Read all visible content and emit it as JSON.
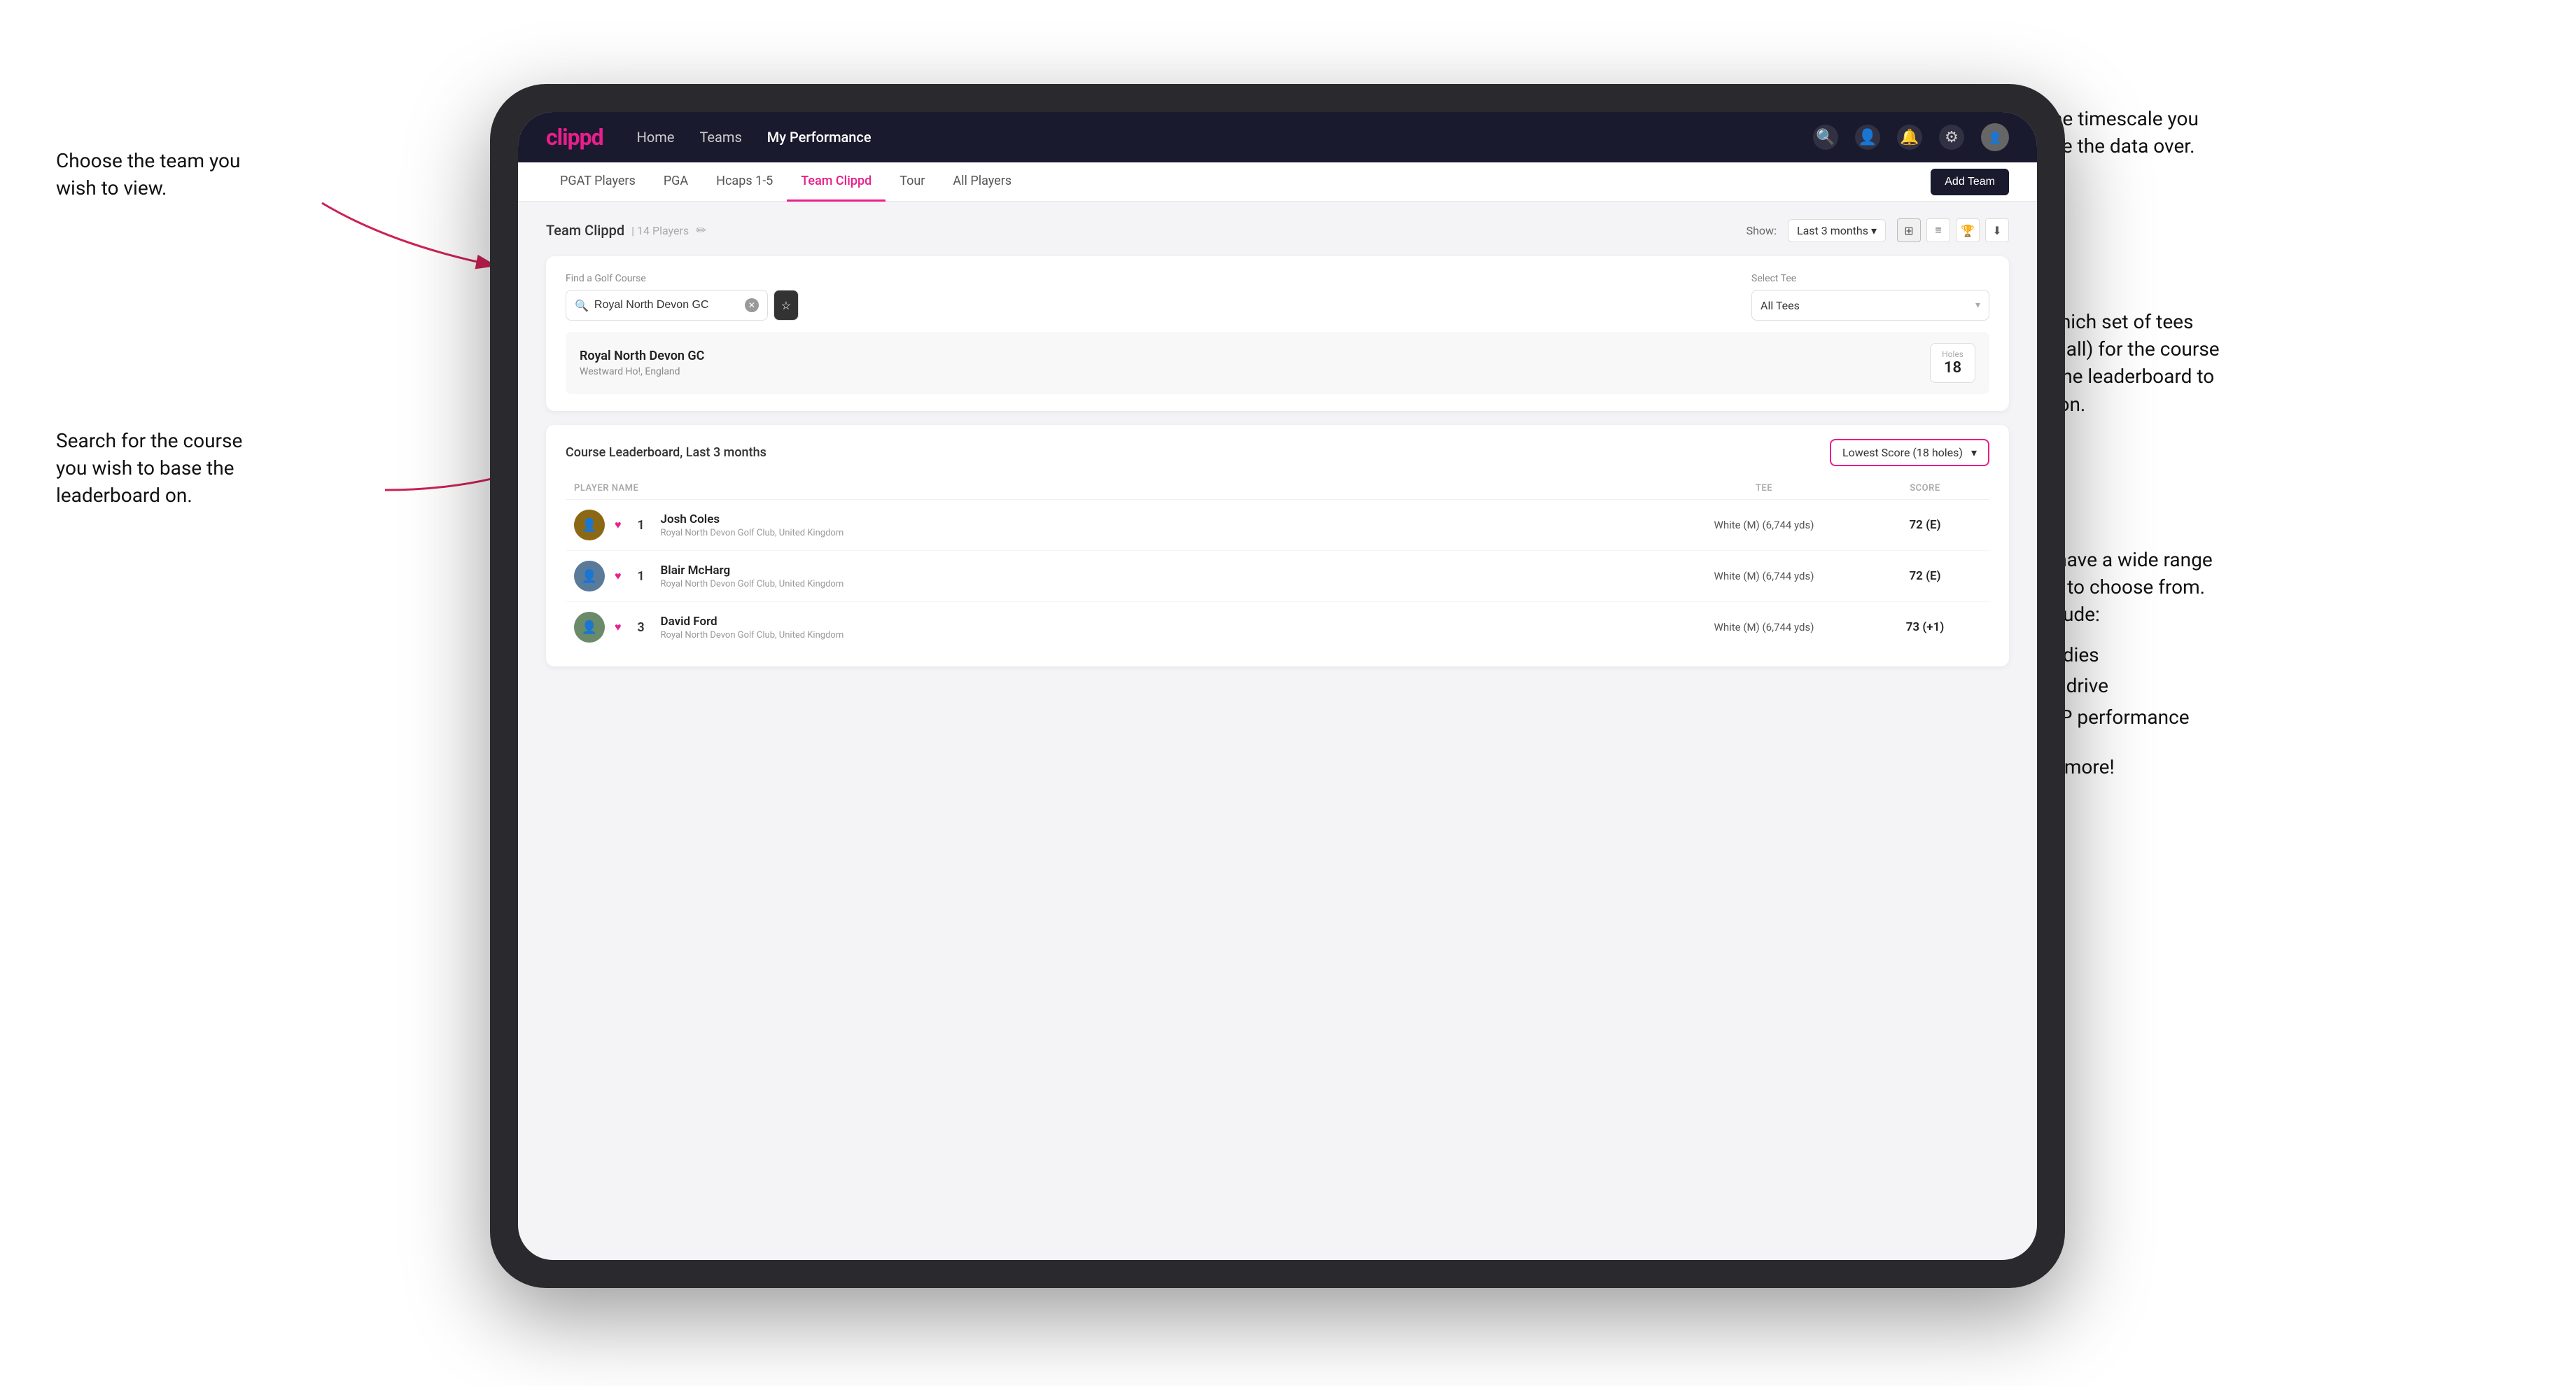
{
  "annotations": {
    "top_left_title": "Choose the team you",
    "top_left_subtitle": "wish to view.",
    "top_right_title": "Choose the timescale you",
    "top_right_subtitle": "wish to see the data over.",
    "mid_right_title": "Choose which set of tees",
    "mid_right_line2": "(default is all) for the course",
    "mid_right_line3": "you wish the leaderboard to",
    "mid_right_line4": "be based on.",
    "bottom_left_title": "Search for the course",
    "bottom_left_line2": "you wish to base the",
    "bottom_left_line3": "leaderboard on.",
    "bottom_right_title": "Here you have a wide range",
    "bottom_right_line2": "of options to choose from.",
    "bottom_right_line3": "These include:",
    "bullet1": "Most birdies",
    "bullet2": "Longest drive",
    "bullet3": "Best APP performance",
    "and_more": "and many more!"
  },
  "navbar": {
    "logo": "clippd",
    "links": [
      "Home",
      "Teams",
      "My Performance"
    ],
    "active_link": "My Performance"
  },
  "subnav": {
    "items": [
      "PGAT Players",
      "PGA",
      "Hcaps 1-5",
      "Team Clippd",
      "Tour",
      "All Players"
    ],
    "active": "Team Clippd",
    "add_team_label": "Add Team"
  },
  "team_header": {
    "title": "Team Clippd",
    "player_count": "14 Players",
    "show_label": "Show:",
    "time_value": "Last 3 months"
  },
  "course_search": {
    "find_label": "Find a Golf Course",
    "search_value": "Royal North Devon GC",
    "select_tee_label": "Select Tee",
    "tee_value": "All Tees",
    "course_name": "Royal North Devon GC",
    "course_location": "Westward Ho!, England",
    "holes_label": "Holes",
    "holes_value": "18"
  },
  "leaderboard": {
    "title": "Course Leaderboard, Last 3 months",
    "score_type": "Lowest Score (18 holes)",
    "columns": {
      "player": "PLAYER NAME",
      "tee": "TEE",
      "score": "SCORE"
    },
    "players": [
      {
        "rank": "1",
        "name": "Josh Coles",
        "club": "Royal North Devon Golf Club, United Kingdom",
        "tee": "White (M) (6,744 yds)",
        "score": "72 (E)"
      },
      {
        "rank": "1",
        "name": "Blair McHarg",
        "club": "Royal North Devon Golf Club, United Kingdom",
        "tee": "White (M) (6,744 yds)",
        "score": "72 (E)"
      },
      {
        "rank": "3",
        "name": "David Ford",
        "club": "Royal North Devon Golf Club, United Kingdom",
        "tee": "White (M) (6,744 yds)",
        "score": "73 (+1)"
      }
    ]
  }
}
